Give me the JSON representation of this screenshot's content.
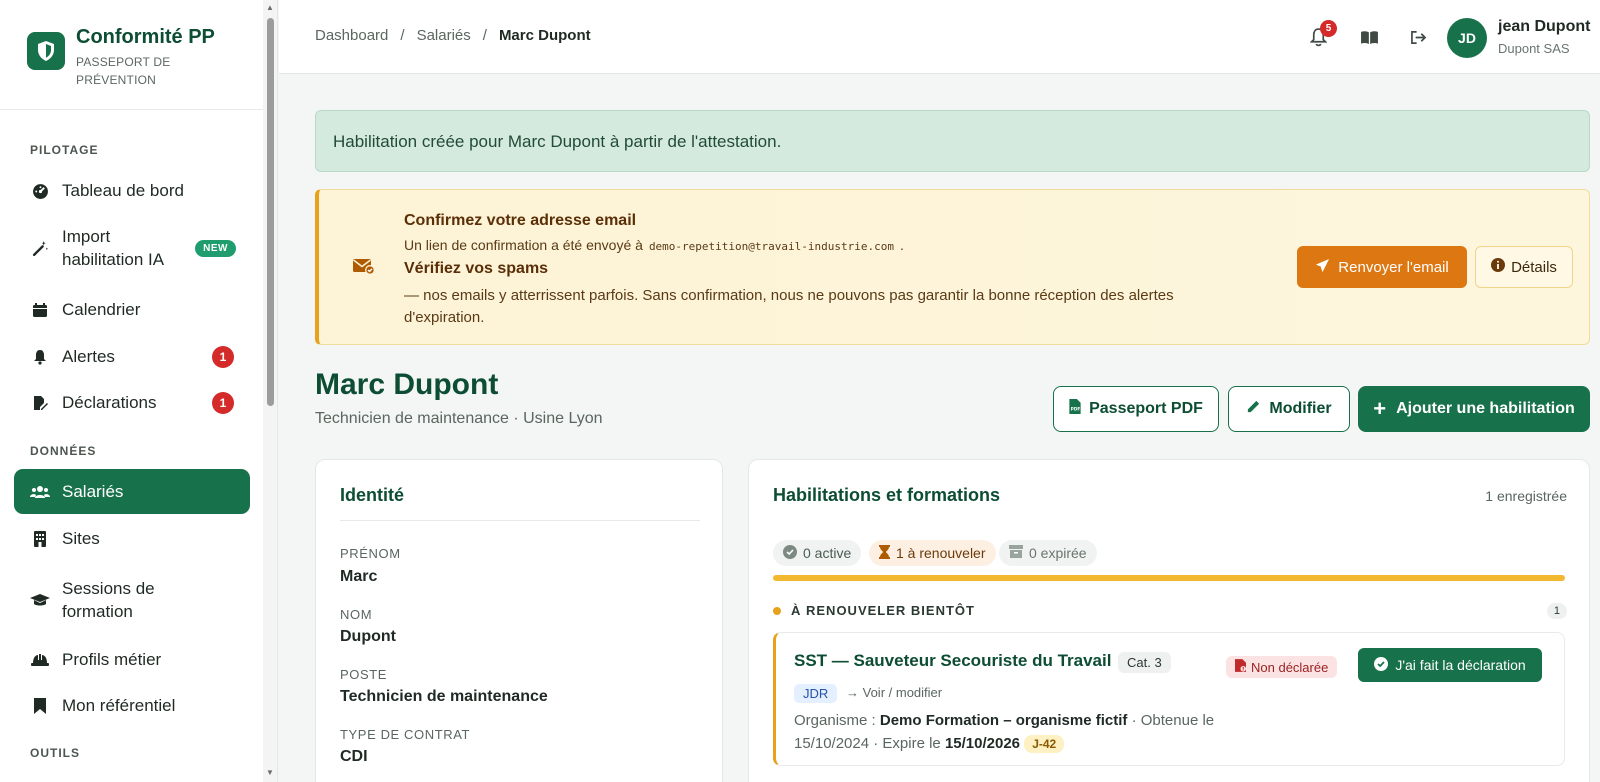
{
  "brand": {
    "title": "Conformité PP",
    "subtitle": "PASSEPORT DE PRÉVENTION"
  },
  "sidebar": {
    "section_pilotage": "PILOTAGE",
    "section_donnees": "DONNÉES",
    "section_outils": "OUTILS",
    "items": [
      {
        "label": "Tableau de bord",
        "icon": "gauge-icon"
      },
      {
        "label": "Import habilitation IA",
        "icon": "magic-wand-icon",
        "badge": "NEW"
      },
      {
        "label": "Calendrier",
        "icon": "calendar-icon"
      },
      {
        "label": "Alertes",
        "icon": "bell-icon",
        "badge": "1"
      },
      {
        "label": "Déclarations",
        "icon": "file-signature-icon",
        "badge": "1"
      },
      {
        "label": "Salariés",
        "icon": "users-icon",
        "active": true
      },
      {
        "label": "Sites",
        "icon": "building-icon"
      },
      {
        "label": "Sessions de formation",
        "icon": "graduation-cap-icon"
      },
      {
        "label": "Profils métier",
        "icon": "hard-hat-icon"
      },
      {
        "label": "Mon référentiel",
        "icon": "bookmark-icon"
      }
    ]
  },
  "breadcrumb": {
    "items": [
      "Dashboard",
      "Salariés",
      "Marc Dupont"
    ],
    "sep": "/"
  },
  "header": {
    "notif_count": "5",
    "avatar_initials": "JD",
    "user_name": "jean Dupont",
    "user_org": "Dupont SAS"
  },
  "success_alert": "Habilitation créée pour Marc Dupont à partir de l'attestation.",
  "email_alert": {
    "title": "Confirmez votre adresse email",
    "line_prefix": "Un lien de confirmation a été envoyé à",
    "email": "demo-repetition@travail-industrie.com",
    "line_suffix": ".",
    "spam_title": "Vérifiez vos spams",
    "spam_text": "— nos emails y atterrissent parfois. Sans confirmation, nous ne pouvons pas garantir la bonne réception des alertes d'expiration.",
    "resend_label": "Renvoyer l'email",
    "details_label": "Détails"
  },
  "person": {
    "name": "Marc Dupont",
    "subtitle": "Technicien de maintenance · Usine Lyon",
    "pdf_label": "Passeport PDF",
    "edit_label": "Modifier",
    "add_label": "Ajouter une habilitation"
  },
  "identity": {
    "title": "Identité",
    "fields": [
      {
        "label": "PRÉNOM",
        "value": "Marc"
      },
      {
        "label": "NOM",
        "value": "Dupont"
      },
      {
        "label": "POSTE",
        "value": "Technicien de maintenance"
      },
      {
        "label": "TYPE DE CONTRAT",
        "value": "CDI"
      }
    ]
  },
  "habilitations": {
    "title": "Habilitations et formations",
    "count_label": "1 enregistrée",
    "chips": {
      "active": "0 active",
      "renew": "1 à renouveler",
      "expired": "0 expirée"
    },
    "section_title": "À RENOUVELER BIENTÔT",
    "section_count": "1",
    "item": {
      "name": "SST — Sauveteur Secouriste du Travail",
      "category": "Cat. 3",
      "status": "Non déclarée",
      "declare_label": "J'ai fait la déclaration",
      "tag": "JDR",
      "edit_link": "Voir / modifier",
      "org_label": "Organisme :",
      "org_value": "Demo Formation – organisme fictif",
      "obtained_label": "· Obtenue le",
      "obtained_date": "15/10/2024",
      "expires_label": "· Expire le",
      "expires_date": "15/10/2026",
      "countdown": "J-42"
    }
  },
  "colors": {
    "brand": "#17714a",
    "warn": "#dd7711",
    "danger": "#d42a2a"
  }
}
